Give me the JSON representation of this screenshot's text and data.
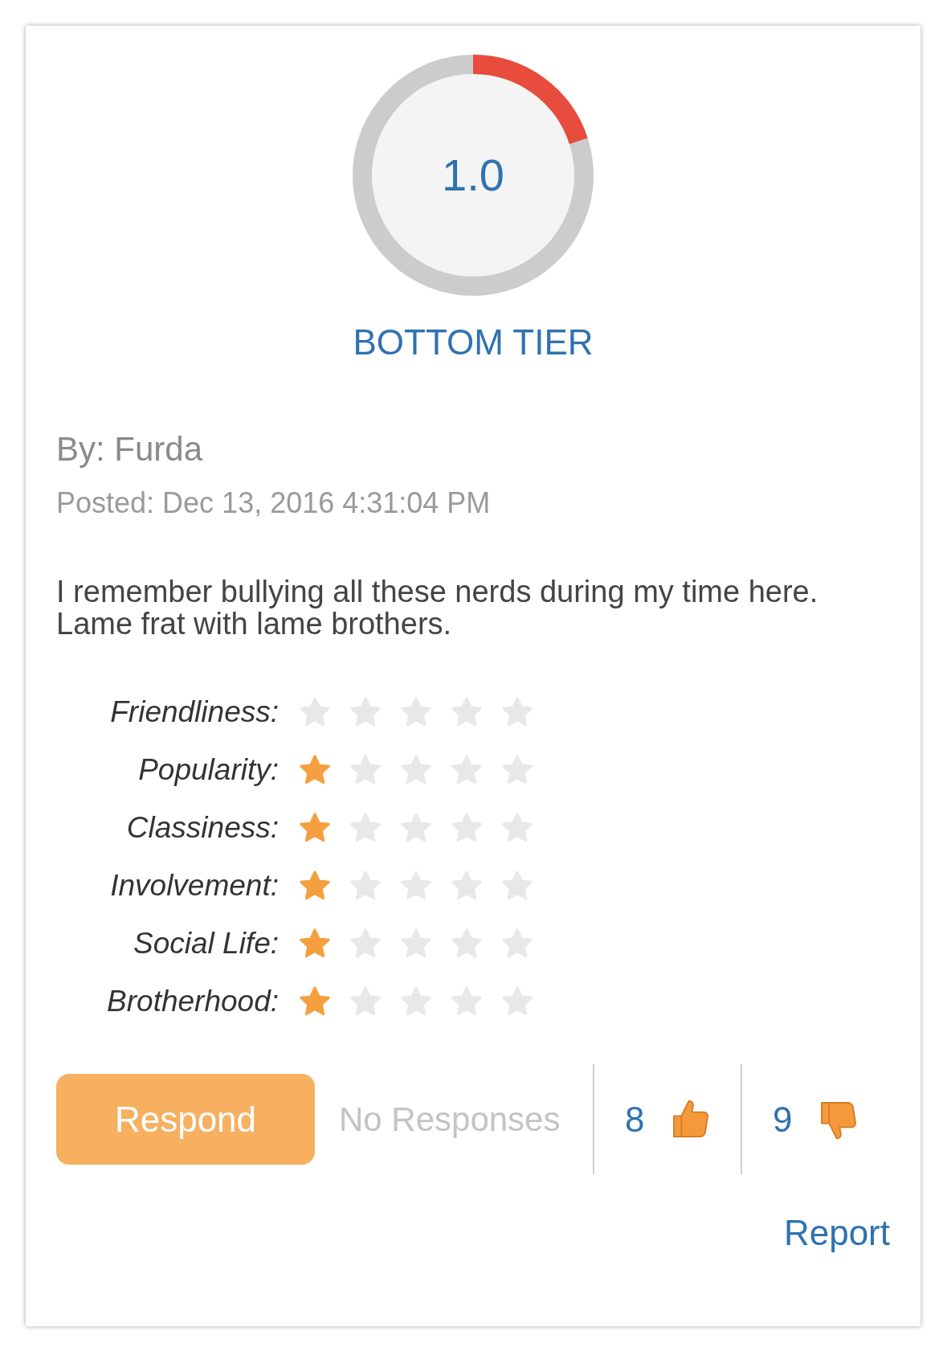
{
  "gauge": {
    "score": "1.0",
    "level": 0.2
  },
  "tier": "BOTTOM TIER",
  "author": "By: Furda",
  "posted": "Posted: Dec 13, 2016 4:31:04 PM",
  "review": "I remember bullying all these nerds during my time here. Lame frat with lame brothers.",
  "ratings": [
    {
      "label": "Friendliness:",
      "stars": 0
    },
    {
      "label": "Popularity:",
      "stars": 1
    },
    {
      "label": "Classiness:",
      "stars": 1
    },
    {
      "label": "Involvement:",
      "stars": 1
    },
    {
      "label": "Social Life:",
      "stars": 1
    },
    {
      "label": "Brotherhood:",
      "stars": 1
    }
  ],
  "respond_button": "Respond",
  "responses": "No Responses",
  "upvotes": "8",
  "downvotes": "9",
  "report_link": "Report"
}
